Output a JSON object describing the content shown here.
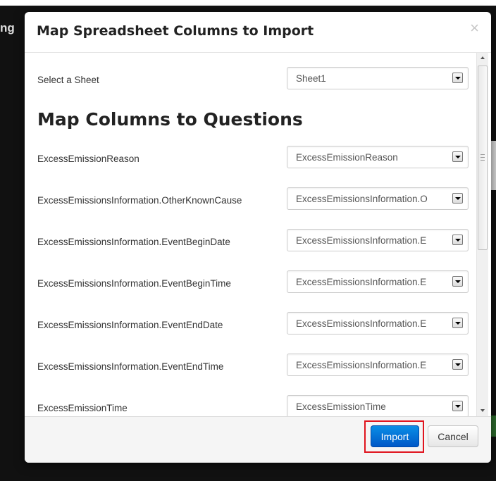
{
  "background": {
    "stub_text": "ng"
  },
  "modal": {
    "title": "Map Spreadsheet Columns to Import",
    "close_glyph": "×",
    "sheet": {
      "label": "Select a Sheet",
      "value": "Sheet1"
    },
    "section_heading": "Map Columns to Questions",
    "mappings": [
      {
        "label": "ExcessEmissionReason",
        "value": "ExcessEmissionReason"
      },
      {
        "label": "ExcessEmissionsInformation.OtherKnownCause",
        "value": "ExcessEmissionsInformation.O"
      },
      {
        "label": "ExcessEmissionsInformation.EventBeginDate",
        "value": "ExcessEmissionsInformation.E"
      },
      {
        "label": "ExcessEmissionsInformation.EventBeginTime",
        "value": "ExcessEmissionsInformation.E"
      },
      {
        "label": "ExcessEmissionsInformation.EventEndDate",
        "value": "ExcessEmissionsInformation.E"
      },
      {
        "label": "ExcessEmissionsInformation.EventEndTime",
        "value": "ExcessEmissionsInformation.E"
      },
      {
        "label": "ExcessEmissionTime",
        "value": "ExcessEmissionTime"
      }
    ],
    "footer": {
      "import_label": "Import",
      "cancel_label": "Cancel"
    }
  },
  "colors": {
    "primary": "#0068d6",
    "highlight": "#e0141e"
  }
}
